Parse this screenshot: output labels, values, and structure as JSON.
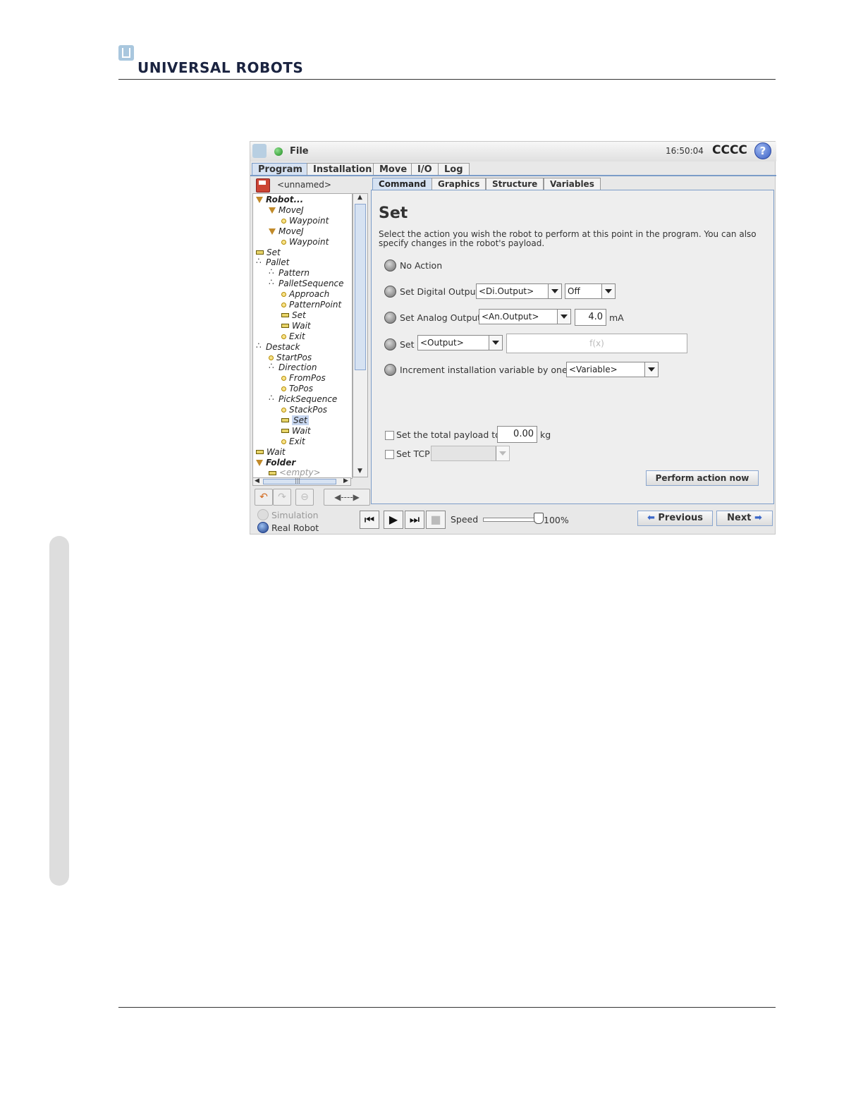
{
  "brand": "UNIVERSAL ROBOTS",
  "app": {
    "file_menu": "File",
    "clock": "16:50:04",
    "robot_name": "CCCC",
    "help": "?",
    "main_tabs": [
      "Program",
      "Installation",
      "Move",
      "I/O",
      "Log"
    ],
    "program_name": "<unnamed>"
  },
  "tree": [
    {
      "label": "Robot...",
      "icon": "triangle-icon"
    },
    {
      "label": "MoveJ",
      "icon": "triangle-icon"
    },
    {
      "label": "Waypoint",
      "icon": "waypoint-icon"
    },
    {
      "label": "MoveJ",
      "icon": "triangle-icon"
    },
    {
      "label": "Waypoint",
      "icon": "waypoint-icon"
    },
    {
      "label": "Set",
      "icon": "command-icon"
    },
    {
      "label": "Pallet",
      "icon": "pallet-icon"
    },
    {
      "label": "Pattern",
      "icon": "pallet-icon"
    },
    {
      "label": "PalletSequence",
      "icon": "pallet-icon"
    },
    {
      "label": "Approach",
      "icon": "waypoint-icon"
    },
    {
      "label": "PatternPoint",
      "icon": "waypoint-icon"
    },
    {
      "label": "Set",
      "icon": "command-icon"
    },
    {
      "label": "Wait",
      "icon": "command-icon"
    },
    {
      "label": "Exit",
      "icon": "waypoint-icon"
    },
    {
      "label": "Destack",
      "icon": "pallet-icon"
    },
    {
      "label": "StartPos",
      "icon": "waypoint-icon"
    },
    {
      "label": "Direction",
      "icon": "pallet-icon"
    },
    {
      "label": "FromPos",
      "icon": "waypoint-icon"
    },
    {
      "label": "ToPos",
      "icon": "waypoint-icon"
    },
    {
      "label": "PickSequence",
      "icon": "pallet-icon"
    },
    {
      "label": "StackPos",
      "icon": "waypoint-icon"
    },
    {
      "label": "Set",
      "icon": "command-icon"
    },
    {
      "label": "Wait",
      "icon": "command-icon"
    },
    {
      "label": "Exit",
      "icon": "waypoint-icon"
    },
    {
      "label": "Wait",
      "icon": "command-icon"
    },
    {
      "label": "Folder",
      "icon": "triangle-icon"
    },
    {
      "label": "<empty>",
      "icon": "command-icon"
    }
  ],
  "tree_scroll_mid": "|||",
  "move_button": "◀----▶",
  "sub_tabs": [
    "Command",
    "Graphics",
    "Structure",
    "Variables"
  ],
  "set_panel": {
    "title": "Set",
    "description": "Select the action you wish the robot to perform at this point in the program. You can also specify changes in the robot's payload.",
    "no_action": "No Action",
    "digital_label": "Set Digital Output",
    "digital_output": "<Di.Output>",
    "digital_value": "Off",
    "analog_label": "Set Analog Output",
    "analog_output": "<An.Output>",
    "analog_value": "4.0",
    "analog_unit": "mA",
    "set_label": "Set",
    "set_output": "<Output>",
    "set_expression": "f(x)",
    "increment_label": "Increment installation variable by one:",
    "increment_variable": "<Variable>",
    "payload_label": "Set the total payload to",
    "payload_value": "0.00",
    "payload_unit": "kg",
    "tcp_label": "Set TCP",
    "perform_button": "Perform action now"
  },
  "bottom": {
    "simulation": "Simulation",
    "real_robot": "Real Robot",
    "speed_label": "Speed",
    "speed_value": "100%",
    "speed_fraction": 1.0,
    "previous": "Previous",
    "next": "Next"
  }
}
